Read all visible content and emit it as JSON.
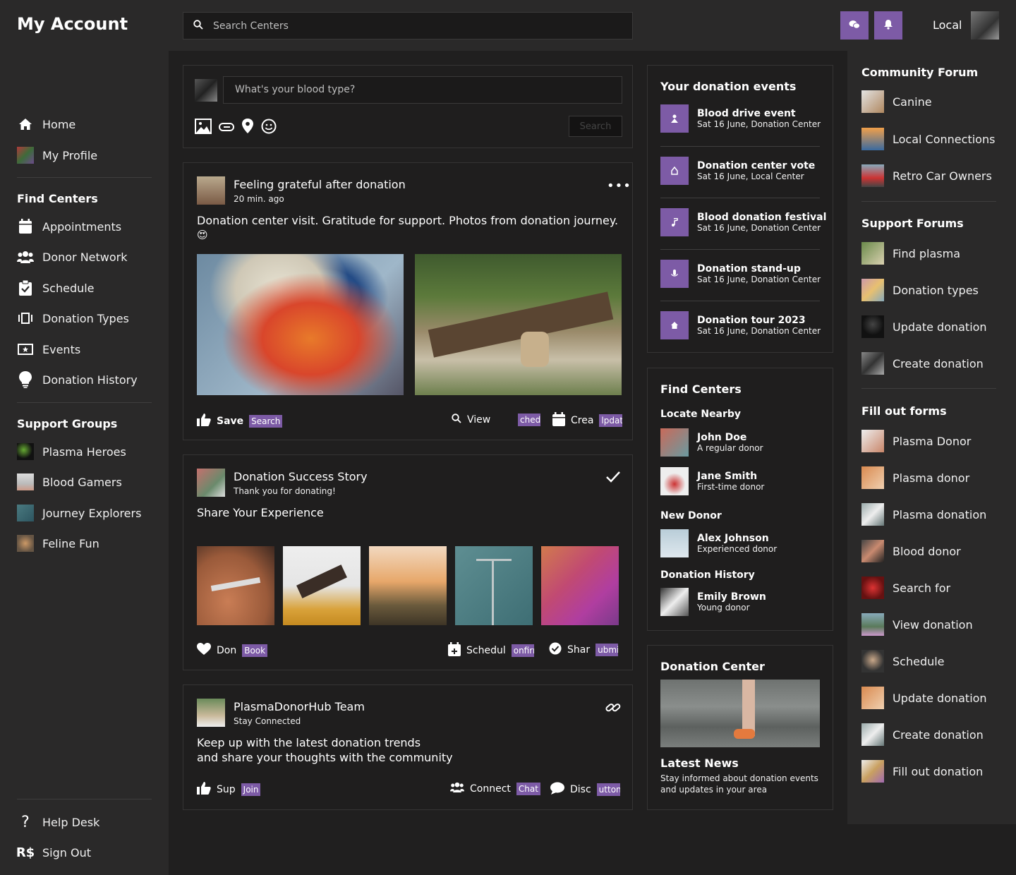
{
  "brand": "My Account",
  "search": {
    "placeholder": "Search Centers"
  },
  "topbar": {
    "local_label": "Local"
  },
  "left_nav": {
    "main": [
      {
        "label": "Home",
        "icon": "home-icon"
      },
      {
        "label": "My Profile",
        "icon": "profile-thumb"
      }
    ],
    "find_centers_heading": "Find Centers",
    "find_centers": [
      {
        "label": "Appointments",
        "icon": "calendar-icon"
      },
      {
        "label": "Donor Network",
        "icon": "users-icon"
      },
      {
        "label": "Schedule",
        "icon": "clipboard-check-icon"
      },
      {
        "label": "Donation Types",
        "icon": "carousel-icon"
      },
      {
        "label": "Events",
        "icon": "ticket-icon"
      },
      {
        "label": "Donation History",
        "icon": "lightbulb-icon"
      }
    ],
    "support_groups_heading": "Support Groups",
    "support_groups": [
      {
        "label": "Plasma Heroes"
      },
      {
        "label": "Blood Gamers"
      },
      {
        "label": "Journey Explorers"
      },
      {
        "label": "Feline Fun"
      }
    ],
    "bottom": [
      {
        "label": "Help Desk",
        "icon": "question-icon"
      },
      {
        "label": "Sign Out",
        "icon": "currency-icon"
      }
    ]
  },
  "composer": {
    "placeholder": "What's your blood type?",
    "button": "Search"
  },
  "posts": [
    {
      "title": "Feeling grateful after donation",
      "sub": "20 min. ago",
      "text": "Donation center visit. Gratitude for support. Photos from donation journey.",
      "emoji": "😍",
      "actions": [
        {
          "label": "Save",
          "tag": "Search"
        },
        {
          "label": "View",
          "tag": "chedu"
        },
        {
          "label": "Crea",
          "tag": "lpdat"
        }
      ]
    },
    {
      "title": "Donation Success Story",
      "sub": "Thank you for donating!",
      "text": "Share Your Experience",
      "actions": [
        {
          "label": "Don",
          "tag": "Book"
        },
        {
          "label": "Schedul",
          "tag": "onfirr"
        },
        {
          "label": "Shar",
          "tag": "ubmi"
        }
      ]
    },
    {
      "title": "PlasmaDonorHub Team",
      "sub": "Stay Connected",
      "text_line1": "Keep up with the latest donation trends",
      "text_line2": "and share your thoughts with the community",
      "actions": [
        {
          "label": "Sup",
          "tag": "Join"
        },
        {
          "label": "Connect",
          "tag": "Chat"
        },
        {
          "label": "Disc",
          "tag": "utton"
        }
      ]
    }
  ],
  "events": {
    "heading": "Your donation events",
    "items": [
      {
        "title": "Blood drive event",
        "sub": "Sat 16 June, Donation Center"
      },
      {
        "title": "Donation center vote",
        "sub": "Sat 16 June, Local Center"
      },
      {
        "title": "Blood donation festival",
        "sub": "Sat 16 June, Donation Center"
      },
      {
        "title": "Donation stand-up",
        "sub": "Sat 16 June, Donation Center"
      },
      {
        "title": "Donation tour 2023",
        "sub": "Sat 16 June, Donation Center"
      }
    ]
  },
  "find_centers": {
    "heading": "Find Centers",
    "groups": [
      {
        "heading": "Locate Nearby",
        "people": [
          {
            "name": "John Doe",
            "sub": "A regular donor"
          },
          {
            "name": "Jane Smith",
            "sub": "First-time donor"
          }
        ]
      },
      {
        "heading": "New Donor",
        "people": [
          {
            "name": "Alex Johnson",
            "sub": "Experienced donor"
          }
        ]
      },
      {
        "heading": "Donation History",
        "people": [
          {
            "name": "Emily Brown",
            "sub": "Young donor"
          }
        ]
      }
    ]
  },
  "donation_center": {
    "heading": "Donation Center",
    "news_heading": "Latest News",
    "news_line1": "Stay informed about donation events",
    "news_line2": "and updates in your area"
  },
  "right_nav": {
    "community_heading": "Community Forum",
    "community": [
      "Canine",
      "Local Connections",
      "Retro Car Owners"
    ],
    "support_heading": "Support Forums",
    "support": [
      "Find plasma",
      "Donation types",
      "Update donation",
      "Create donation"
    ],
    "forms_heading": "Fill out forms",
    "forms": [
      "Plasma Donor",
      "Plasma donor",
      "Plasma donation",
      "Blood donor",
      "Search for",
      "View donation",
      "Schedule",
      "Update donation",
      "Create donation",
      "Fill out donation"
    ]
  },
  "colors": {
    "accent": "#7d5ba6",
    "panel": "#2a2929",
    "background": "#201f1f"
  }
}
